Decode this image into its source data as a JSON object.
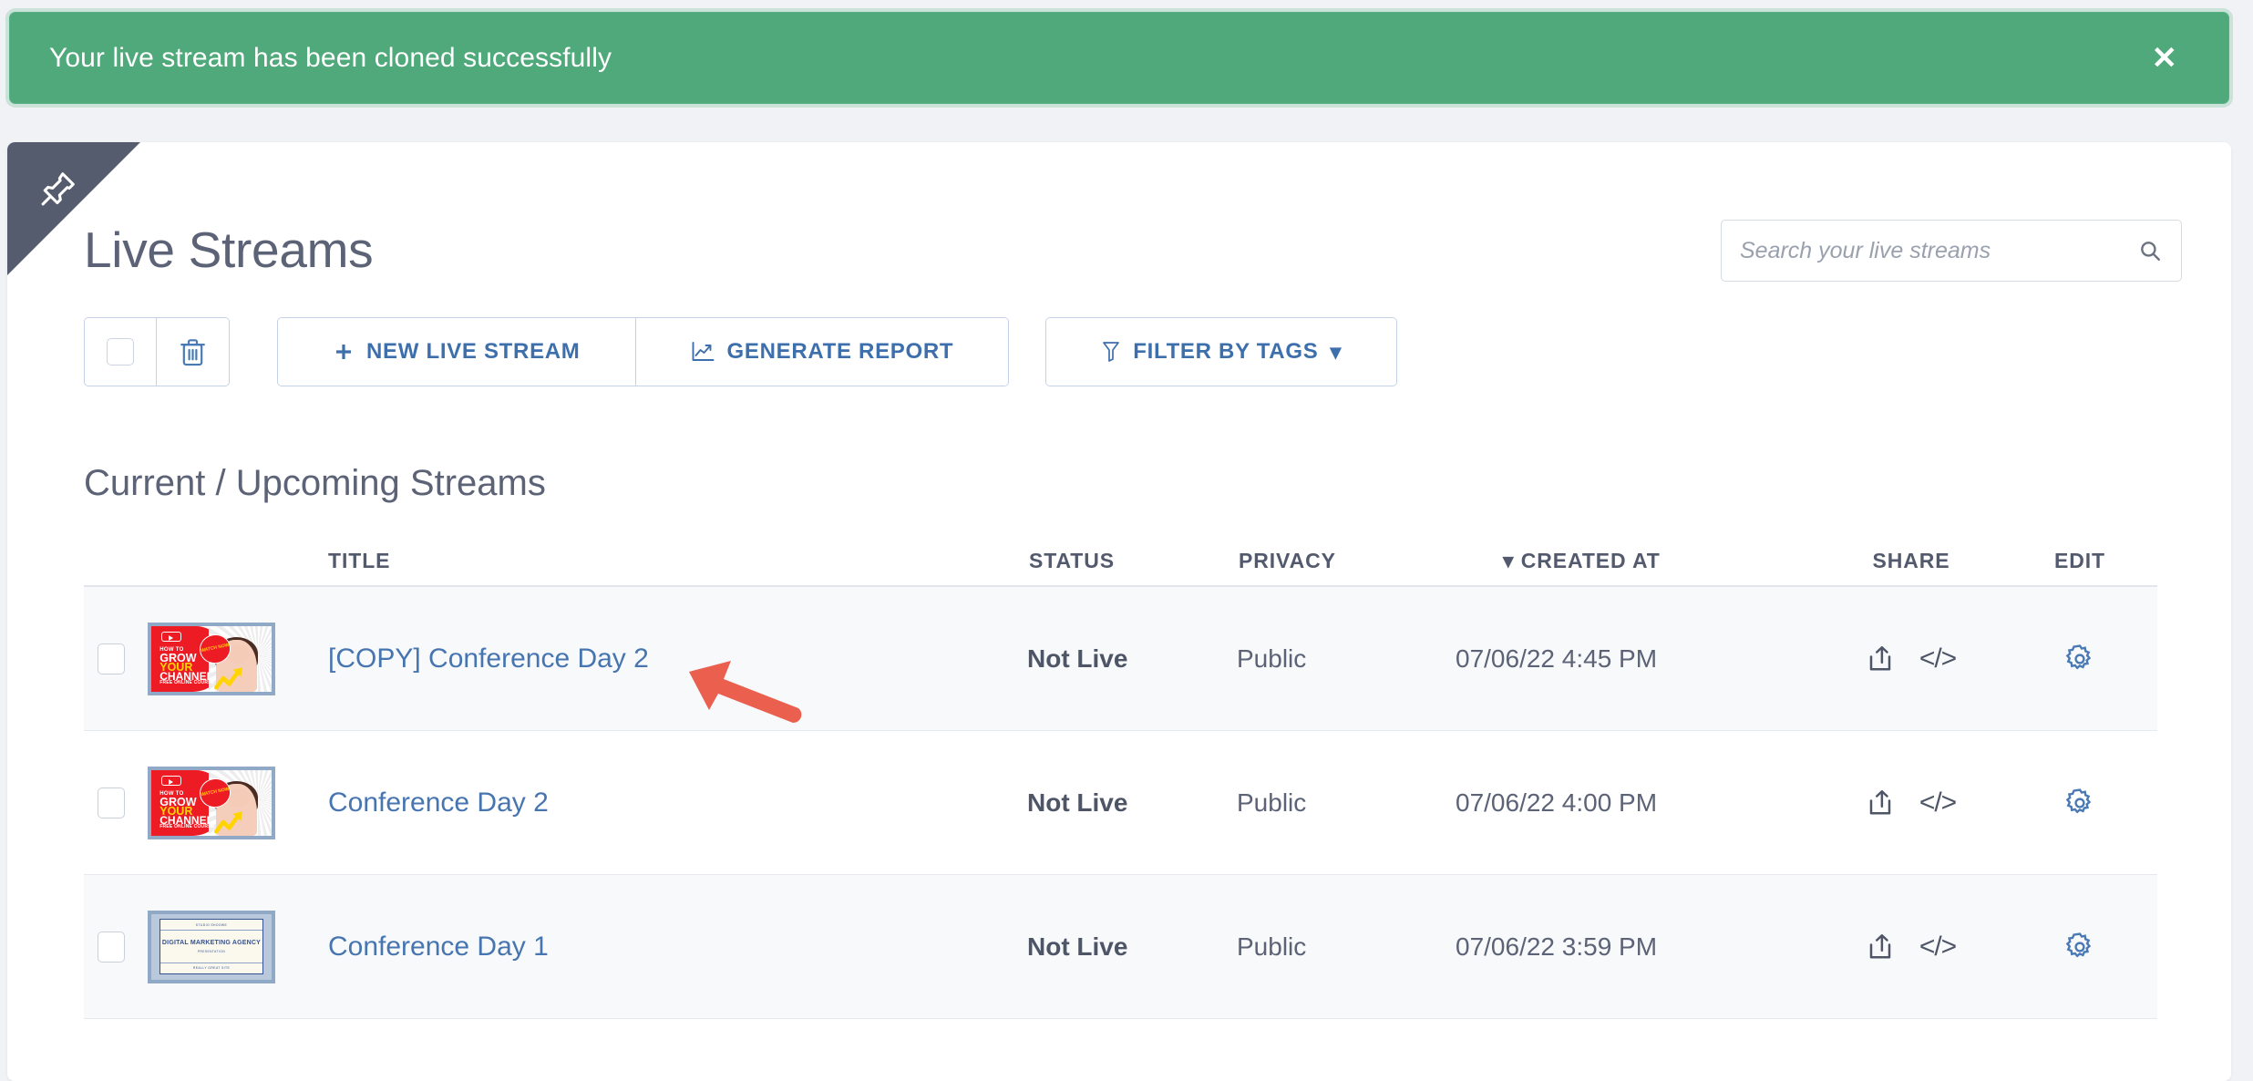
{
  "alert": {
    "message": "Your live stream has been cloned successfully",
    "close_label": "✕",
    "color": "#4fa97a"
  },
  "page": {
    "title": "Live Streams",
    "pin_icon": "pin-icon"
  },
  "search": {
    "placeholder": "Search your live streams",
    "value": "",
    "icon": "search-icon"
  },
  "toolbar": {
    "select_all_label": "",
    "delete_label": "",
    "new_live_stream": "NEW LIVE STREAM",
    "new_live_stream_icon": "plus-icon",
    "generate_report": "GENERATE REPORT",
    "generate_report_icon": "chart-line-icon",
    "filter_by_tags": "FILTER BY TAGS",
    "filter_icon": "funnel-icon",
    "filter_caret": "▾"
  },
  "section": {
    "heading": "Current / Upcoming Streams"
  },
  "table": {
    "sort_indicator": "▾",
    "columns": {
      "title": "TITLE",
      "status": "STATUS",
      "privacy": "PRIVACY",
      "created_at": "CREATED AT",
      "share": "SHARE",
      "edit": "EDIT"
    },
    "rows": [
      {
        "title": "[COPY] Conference Day 2",
        "status": "Not Live",
        "privacy": "Public",
        "created_at": "07/06/22 4:45 PM",
        "thumbnail": "grow-your-channel",
        "thumb_text": {
          "howto": "HOW TO",
          "grow": "GROW",
          "your": "YOUR",
          "channel": "CHANNEL",
          "free": "FREE ONLINE COURSE",
          "badge": "WATCH NOW"
        }
      },
      {
        "title": "Conference Day 2",
        "status": "Not Live",
        "privacy": "Public",
        "created_at": "07/06/22 4:00 PM",
        "thumbnail": "grow-your-channel",
        "thumb_text": {
          "howto": "HOW TO",
          "grow": "GROW",
          "your": "YOUR",
          "channel": "CHANNEL",
          "free": "FREE ONLINE COURSE",
          "badge": "WATCH NOW"
        }
      },
      {
        "title": "Conference Day 1",
        "status": "Not Live",
        "privacy": "Public",
        "created_at": "07/06/22 3:59 PM",
        "thumbnail": "digital-marketing-agency",
        "thumb_text": {
          "top": "STUDIO SHOOWE",
          "title": "DIGITAL MARKETING AGENCY",
          "sub": "PRESENTATION",
          "bottom": "REALLY GREAT SITE"
        }
      }
    ],
    "row_icons": {
      "share": "share-icon",
      "embed": "</>",
      "edit": "gear-icon"
    }
  },
  "annotation": {
    "arrow_color": "#ea5f4d"
  },
  "colors": {
    "link": "#4775b0",
    "accent_blue": "#3d6fad",
    "text_slate": "#5c6377"
  }
}
